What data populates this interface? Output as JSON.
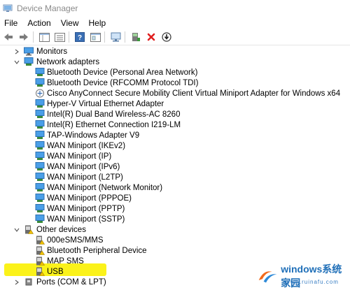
{
  "window": {
    "title": "Device Manager"
  },
  "menu": [
    "File",
    "Action",
    "View",
    "Help"
  ],
  "toolbar": {
    "buttons": [
      "back-icon",
      "forward-icon",
      "view-toggle-icon",
      "properties-list-icon",
      "help-icon",
      "details-icon",
      "monitor-scan-icon",
      "update-driver-icon",
      "uninstall-icon",
      "download-icon"
    ]
  },
  "tree": {
    "monitors": "Monitors",
    "network_adapters": "Network adapters",
    "adapters": [
      "Bluetooth Device (Personal Area Network)",
      "Bluetooth Device (RFCOMM Protocol TDI)",
      "Cisco AnyConnect Secure Mobility Client Virtual Miniport Adapter for Windows x64",
      "Hyper-V Virtual Ethernet Adapter",
      "Intel(R) Dual Band Wireless-AC 8260",
      "Intel(R) Ethernet Connection I219-LM",
      "TAP-Windows Adapter V9",
      "WAN Miniport (IKEv2)",
      "WAN Miniport (IP)",
      "WAN Miniport (IPv6)",
      "WAN Miniport (L2TP)",
      "WAN Miniport (Network Monitor)",
      "WAN Miniport (PPPOE)",
      "WAN Miniport (PPTP)",
      "WAN Miniport (SSTP)"
    ],
    "other_devices": "Other devices",
    "others": [
      "000eSMS/MMS",
      "Bluetooth Peripheral Device",
      "MAP SMS",
      "USB"
    ],
    "ports": "Ports (COM & LPT)"
  },
  "watermark": {
    "brand": "windows系统家园",
    "sub": "www.ruinafu.com"
  },
  "colors": {
    "highlight": "#fbf21a",
    "accent": "#1f6fb8"
  }
}
